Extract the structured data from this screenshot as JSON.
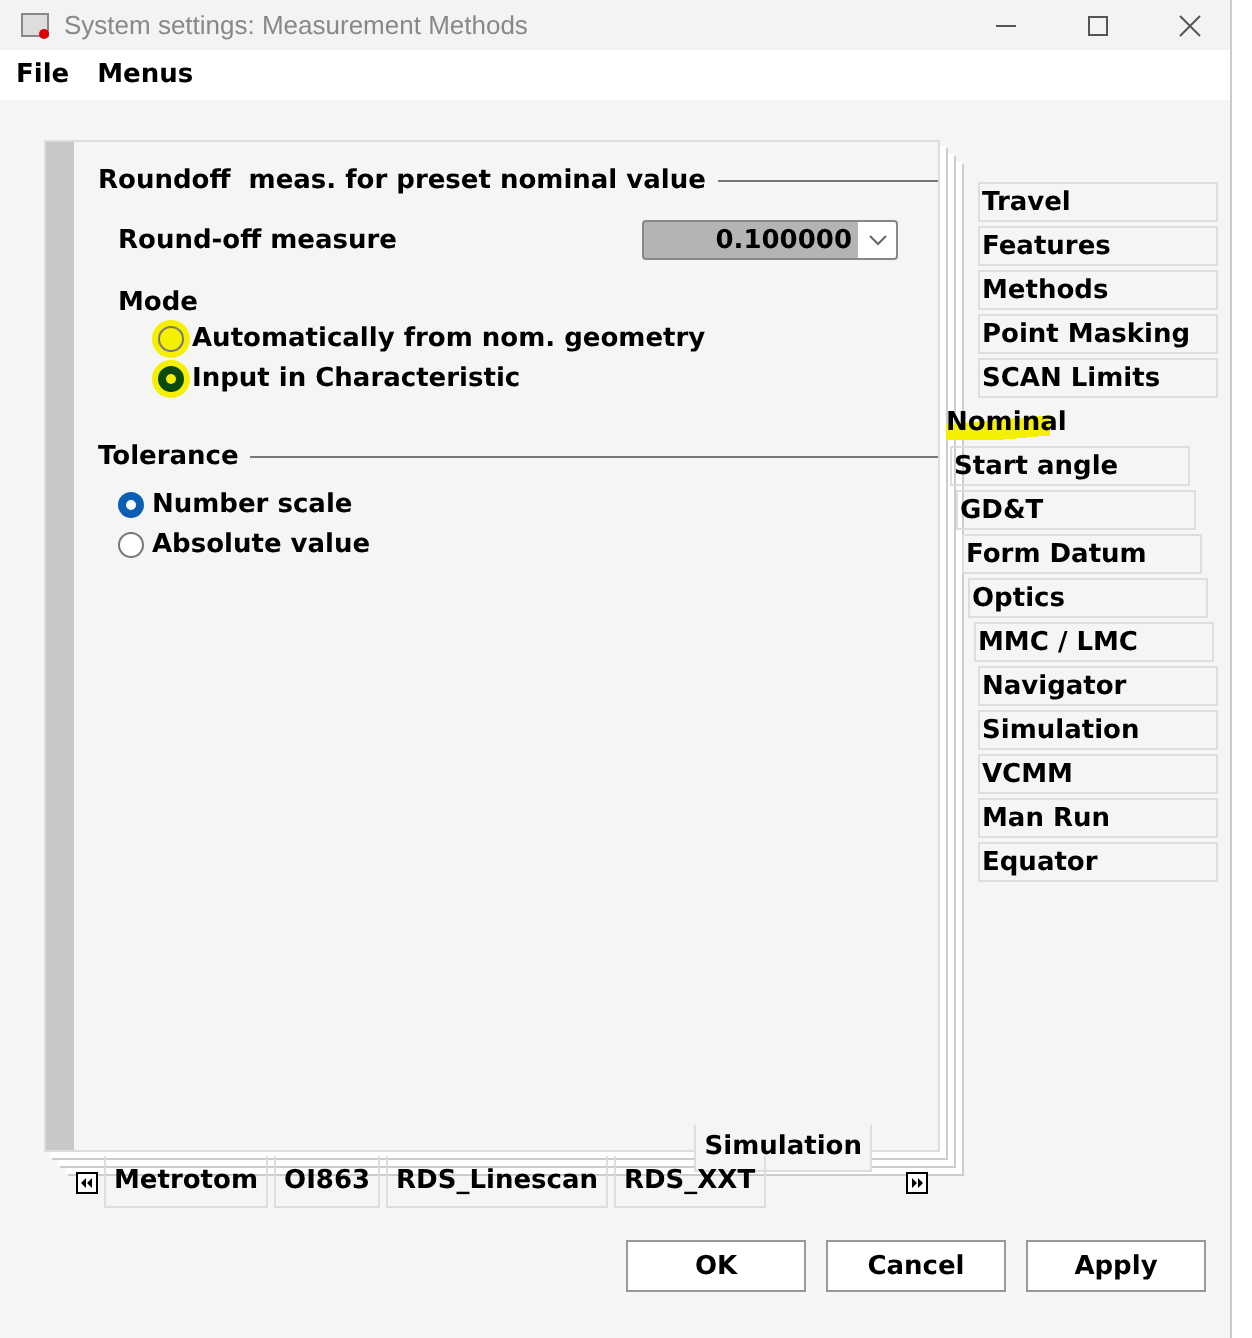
{
  "window": {
    "title": "System settings: Measurement Methods"
  },
  "menu": [
    "File",
    "Menus"
  ],
  "roundoff": {
    "heading": "Roundoff  meas. for preset nominal value",
    "label": "Round-off measure",
    "value": "0.100000",
    "mode_label": "Mode",
    "modes": [
      {
        "label": "Automatically from nom. geometry",
        "selected": false,
        "highlighted": true
      },
      {
        "label": "Input in Characteristic",
        "selected": true,
        "highlighted": true
      }
    ]
  },
  "tolerance": {
    "heading": "Tolerance",
    "options": [
      {
        "label": "Number scale",
        "selected": true
      },
      {
        "label": "Absolute value",
        "selected": false
      }
    ]
  },
  "side_tabs": [
    {
      "label": "Travel",
      "selected": false,
      "highlighted": false
    },
    {
      "label": "Features",
      "selected": false,
      "highlighted": false
    },
    {
      "label": "Methods",
      "selected": false,
      "highlighted": false
    },
    {
      "label": "Point Masking",
      "selected": false,
      "highlighted": false
    },
    {
      "label": "SCAN Limits",
      "selected": false,
      "highlighted": false
    },
    {
      "label": "Nominal",
      "selected": true,
      "highlighted": true
    },
    {
      "label": "Start angle",
      "selected": false,
      "highlighted": false
    },
    {
      "label": "GD&T",
      "selected": false,
      "highlighted": false
    },
    {
      "label": "Form Datum",
      "selected": false,
      "highlighted": false
    },
    {
      "label": "Optics",
      "selected": false,
      "highlighted": false
    },
    {
      "label": "MMC / LMC",
      "selected": false,
      "highlighted": false
    },
    {
      "label": "Navigator",
      "selected": false,
      "highlighted": false
    },
    {
      "label": "Simulation",
      "selected": false,
      "highlighted": false
    },
    {
      "label": "VCMM",
      "selected": false,
      "highlighted": false
    },
    {
      "label": "Man Run",
      "selected": false,
      "highlighted": false
    },
    {
      "label": "Equator",
      "selected": false,
      "highlighted": false
    }
  ],
  "bottom_selected_tab": {
    "label": "Simulation",
    "selected": true
  },
  "bottom_tabs": [
    {
      "label": "Metrotom",
      "selected": false
    },
    {
      "label": "OI863",
      "selected": false
    },
    {
      "label": "RDS_Linescan",
      "selected": false
    },
    {
      "label": "RDS_XXT",
      "selected": false
    }
  ],
  "buttons": [
    "OK",
    "Cancel",
    "Apply"
  ]
}
